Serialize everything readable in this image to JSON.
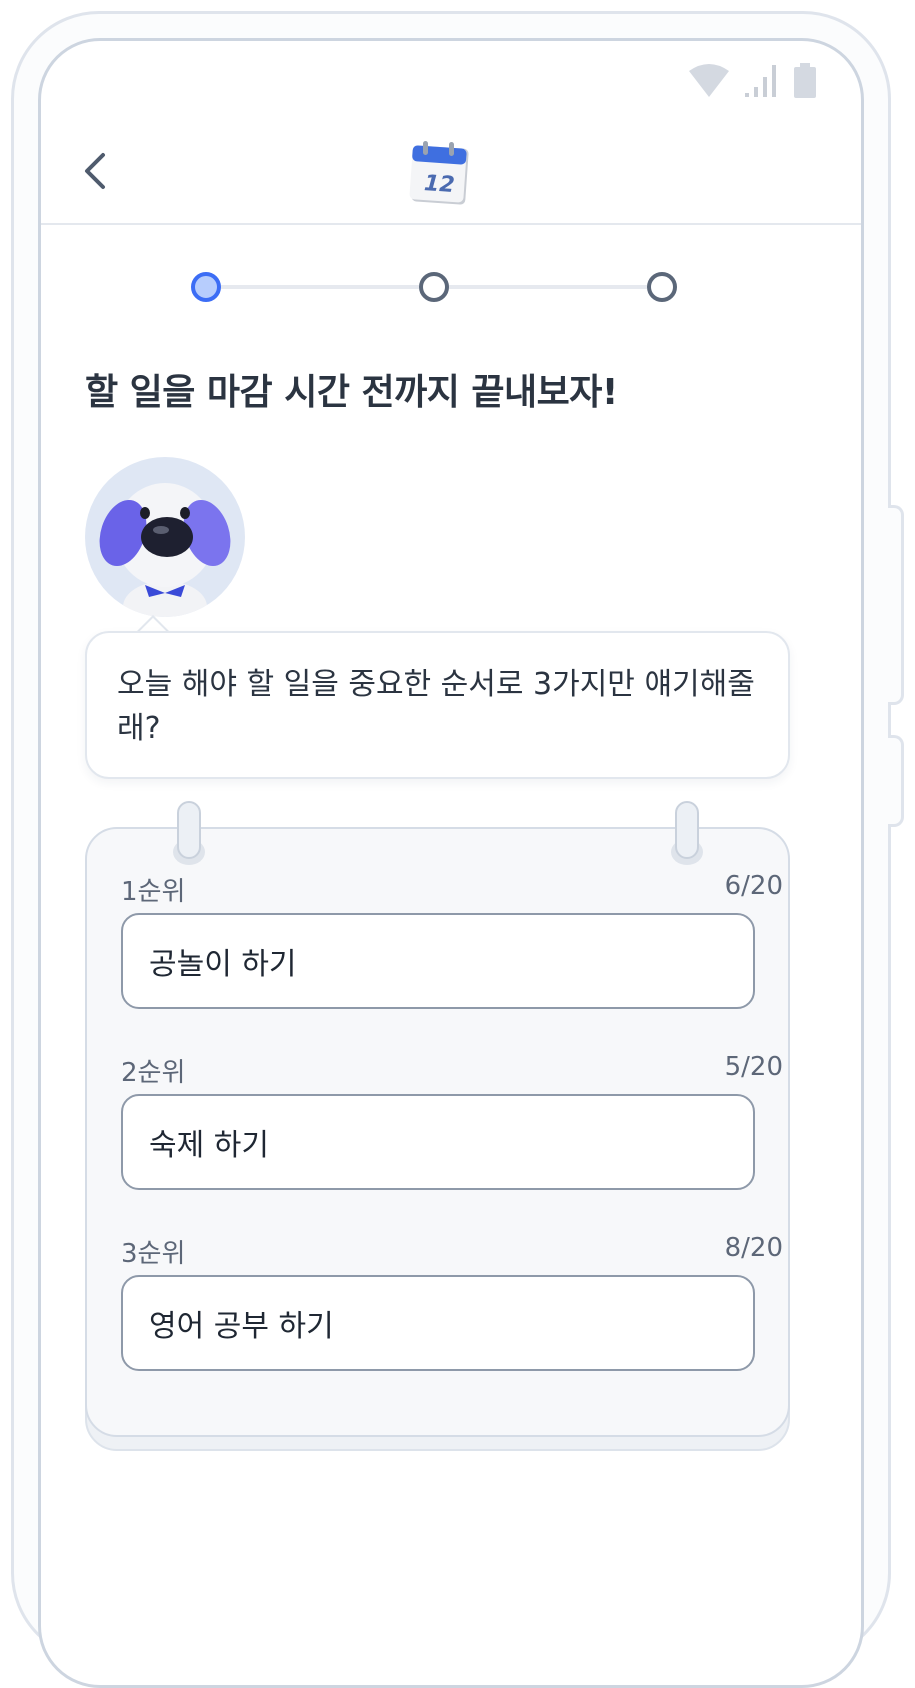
{
  "header": {
    "back_icon": "chevron-left-icon",
    "calendar_day": "12"
  },
  "status_bar": {
    "icons": [
      "wifi-icon",
      "signal-icon",
      "battery-icon"
    ]
  },
  "stepper": {
    "steps": 3,
    "current": 1,
    "colors": {
      "active_fill": "#b7cdfd",
      "active_border": "#3c6df5",
      "idle_border": "#5b6779"
    }
  },
  "headline": "할 일을 마감 시간 전까지 끝내보자!",
  "bubble": {
    "message": "오늘 해야 할 일을 중요한 순서로 3가지만 얘기해줄래?"
  },
  "priorities": [
    {
      "label": "1순위",
      "count": "6/20",
      "value": "공놀이 하기"
    },
    {
      "label": "2순위",
      "count": "5/20",
      "value": "숙제 하기"
    },
    {
      "label": "3순위",
      "count": "8/20",
      "value": "영어 공부 하기"
    }
  ]
}
